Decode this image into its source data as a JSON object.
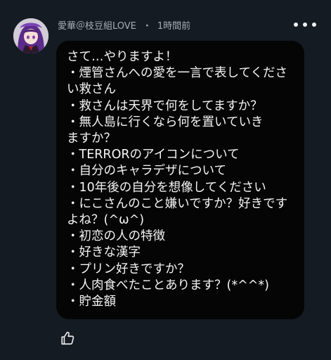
{
  "comment": {
    "author": "愛華＠枝豆組LOVE",
    "separator": "・",
    "time": "1時間前",
    "text": "さて…やりますよ！\n・煙管さんへの愛を一言で表してくださ\nい救さん\n・救さんは天界で何をしてますか？\n・無人島に行くなら何を置いていき\nますか？\n・TERRORのアイコンについて\n・自分のキャラデザについて\n・10年後の自分を想像してください\n・にこさんのこと嫌いですか？好きです\nよね？(^ω^)\n・初恋の人の特徴\n・好きな漢字\n・プリン好きですか？\n・人肉食べたことあります？(*^^*)\n・貯金額"
  },
  "icons": {
    "more": "more-horizontal-icon",
    "like": "thumbs-up-icon"
  },
  "colors": {
    "background": "#141b23",
    "bubble": "#050505",
    "meta_text": "#a7adb5",
    "body_text": "#f4f4f4"
  }
}
